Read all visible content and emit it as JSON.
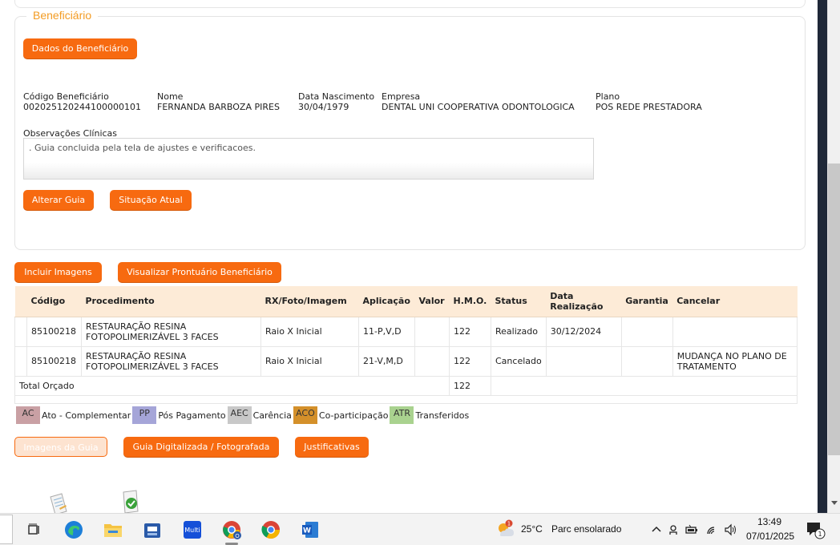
{
  "section": {
    "legend": "Beneficiário",
    "dados_button": "Dados do Beneficiário",
    "fields": [
      {
        "label": "Código Beneficiário",
        "value": "00202512024410000010 1"
      },
      {
        "label": "Nome",
        "value": "FERNANDA BARBOZA PIRES"
      },
      {
        "label": "Data Nascimento",
        "value": "30/04/1979"
      },
      {
        "label": "Empresa",
        "value": "DENTAL UNI COOPERATIVA ODONTOLOGICA"
      },
      {
        "label": "Plano",
        "value": "POS REDE PRESTADORA"
      }
    ],
    "obs_label": "Observações Clínicas",
    "obs_text": ". Guia concluida pela tela de ajustes e verificacoes.",
    "alterar_button": "Alterar Guia",
    "situacao_button": "Situação Atual"
  },
  "actions": {
    "incluir": "Incluir Imagens",
    "visualizar": "Visualizar Prontuário Beneficiário"
  },
  "table": {
    "headers": [
      "Código",
      "Procedimento",
      "RX/Foto/Imagem",
      "Aplicação",
      "Valor",
      "H.M.O.",
      "Status",
      "Data Realização",
      "Garantia",
      "Cancelar"
    ],
    "rows": [
      {
        "codigo": "85100218",
        "procedimento": "RESTAURAÇÃO RESINA FOTOPOLIMERIZÁVEL 3 FACES",
        "rx": "Raio X Inicial",
        "aplicacao": "11-P,V,D",
        "valor": "",
        "hmo": "122",
        "status": "Realizado",
        "data": "30/12/2024",
        "garantia": "",
        "cancelar": ""
      },
      {
        "codigo": "85100218",
        "procedimento": "RESTAURAÇÃO RESINA FOTOPOLIMERIZÁVEL 3 FACES",
        "rx": "Raio X Inicial",
        "aplicacao": "21-V,M,D",
        "valor": "",
        "hmo": "122",
        "status": "Cancelado",
        "data": "",
        "garantia": "",
        "cancelar": "MUDANÇA NO PLANO DE TRATAMENTO"
      }
    ],
    "total_label": "Total Orçado",
    "total_hmo": "122"
  },
  "legend_items": [
    {
      "code": "AC",
      "text": "Ato - Complementar",
      "color": "#c9a0a4"
    },
    {
      "code": "PP",
      "text": "Pós Pagamento",
      "color": "#a5a5d8"
    },
    {
      "code": "AEC",
      "text": "Carência",
      "color": "#c8c8c8"
    },
    {
      "code": "ACO",
      "text": "Co-participação",
      "color": "#d4902a"
    },
    {
      "code": "ATR",
      "text": "Transferidos",
      "color": "#a9d28f"
    }
  ],
  "bottom_buttons": {
    "imagens": "Imagens da Guia",
    "digitalizada": "Guia Digitalizada / Fotografada",
    "justificativas": "Justificativas"
  },
  "taskbar": {
    "weather_temp": "25°C",
    "weather_text": "Parc ensolarado",
    "weather_badge": "1",
    "time": "13:49",
    "date": "07/01/2025",
    "notif_count": "1",
    "accent": "#f76a10"
  }
}
